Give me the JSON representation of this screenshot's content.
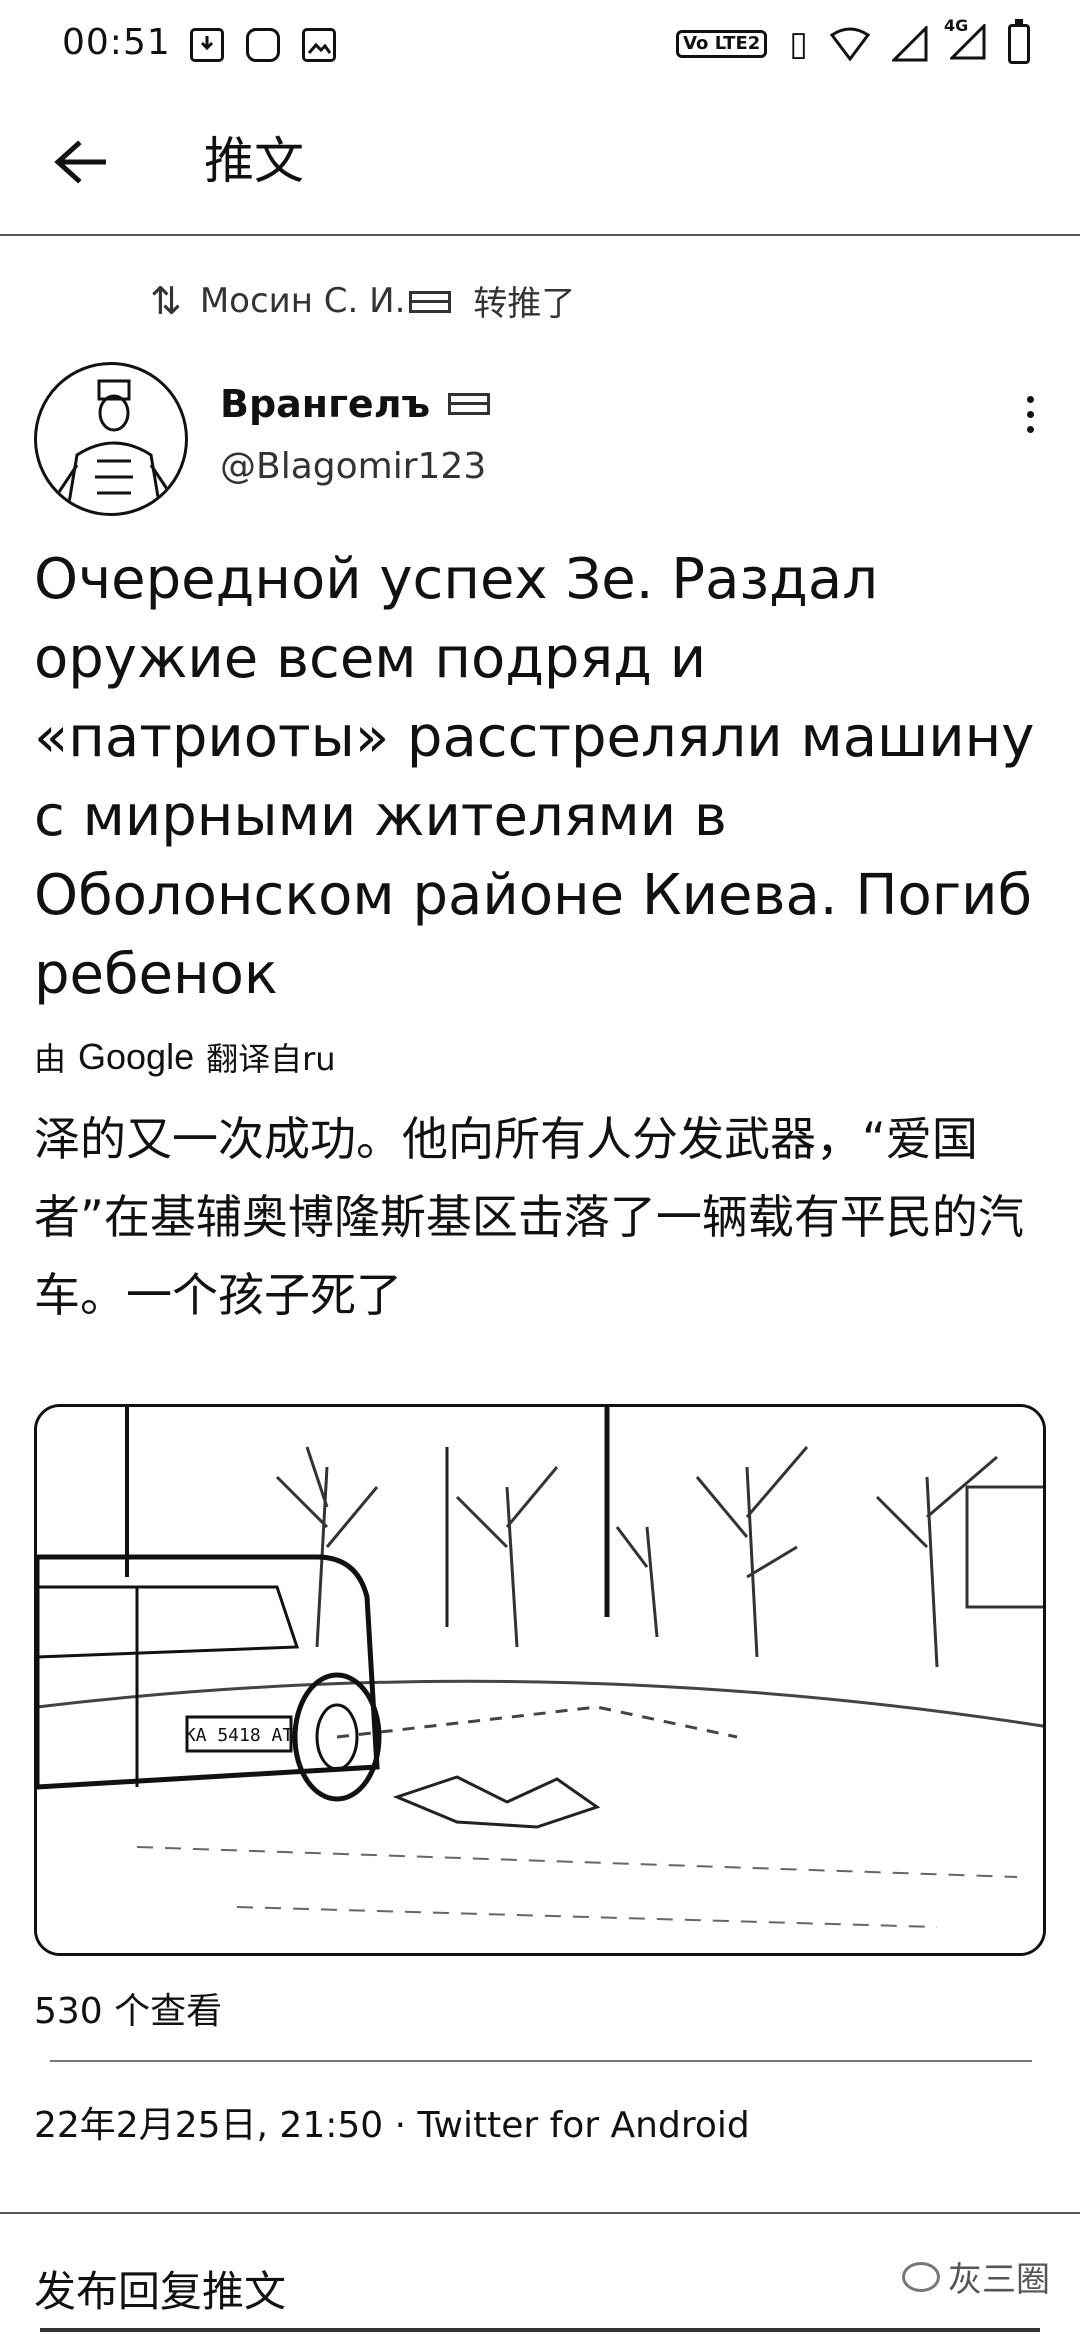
{
  "status_bar": {
    "time": "00:51",
    "left_icons": [
      "download-icon",
      "link-icon",
      "image-icon"
    ],
    "right_icons": [
      "volte-icon",
      "vibrate-icon",
      "wifi-icon",
      "signal-icon",
      "signal-4g-icon",
      "battery-icon"
    ],
    "volte_label": "Vo LTE2",
    "signal_4g_label": "4G"
  },
  "header": {
    "back_icon": "arrow-left-icon",
    "title": "推文"
  },
  "retweet": {
    "icon": "retweet-icon",
    "user": "Мосин С. И.",
    "suffix": "转推了"
  },
  "author": {
    "display_name": "Врангелъ",
    "handle": "@Blagomir123",
    "more_icon": "more-vertical-icon"
  },
  "tweet": {
    "text": "Очередной успех Зе. Раздал оружие всем подряд и «патриоты» расстреляли машину с мирными жителями в Оболонском районе Киева. Погиб ребенок",
    "translated_prefix": "由",
    "translated_provider": "Google",
    "translated_suffix": "翻译自ru",
    "translation": "泽的又一次成功。他向所有人分发武器，“爱国者”在基辅奥博隆斯基区击落了一辆载有平民的汽车。一个孩子死了"
  },
  "media": {
    "plate_text": "KA 5418 AT"
  },
  "meta": {
    "views": "530 个查看",
    "timestamp": "22年2月25日, 21:50 · Twitter for Android"
  },
  "reply": {
    "label": "发布回复推文"
  },
  "watermark": {
    "text": "灰三圈"
  }
}
